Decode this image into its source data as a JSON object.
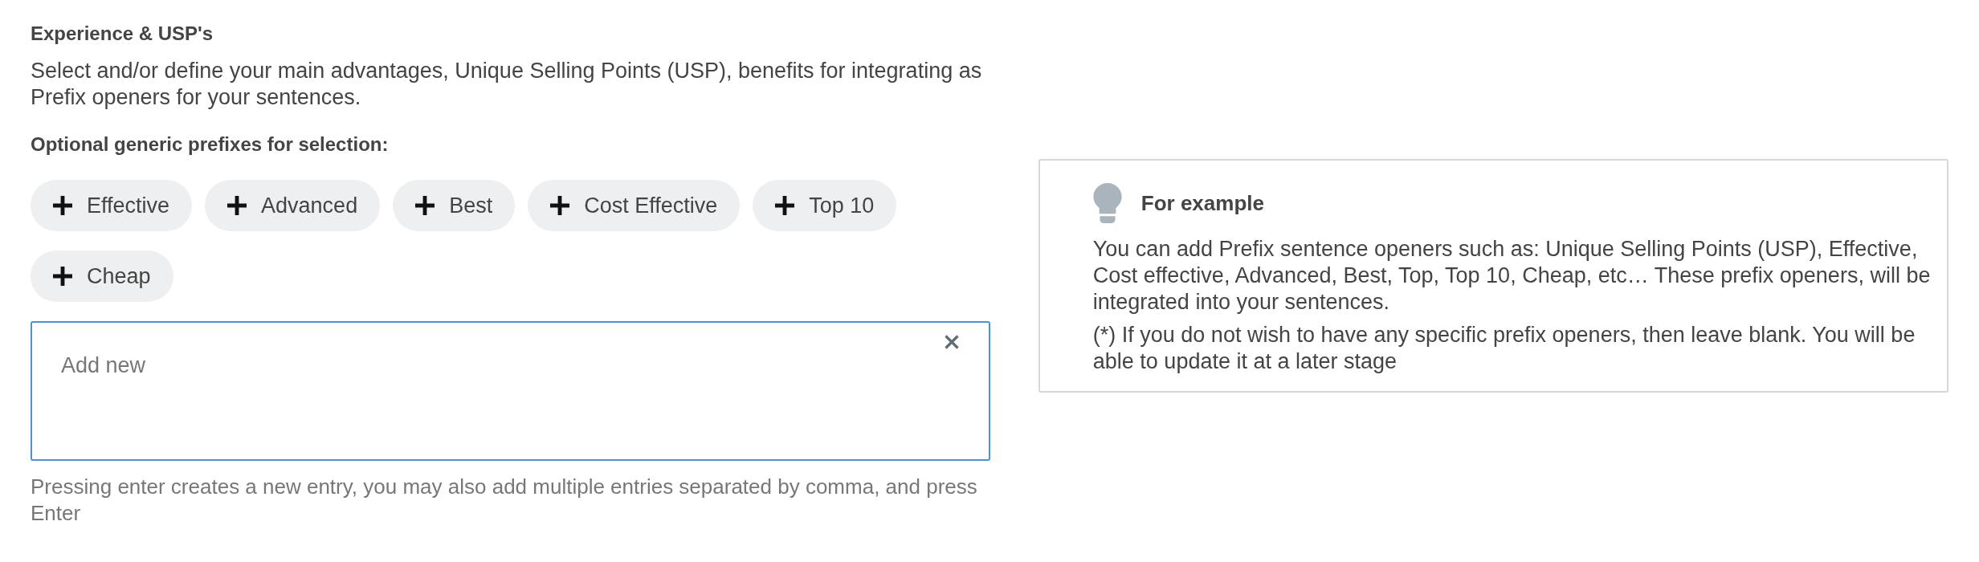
{
  "section": {
    "title": "Experience & USP's",
    "description": "Select and/or define your main advantages, Unique Selling Points (USP), benefits for integrating as Prefix openers for your sentences.",
    "prefixes_label": "Optional generic prefixes for selection:"
  },
  "prefixes": [
    {
      "label": "Effective"
    },
    {
      "label": "Advanced"
    },
    {
      "label": "Best"
    },
    {
      "label": "Cost Effective"
    },
    {
      "label": "Top 10"
    },
    {
      "label": "Cheap"
    }
  ],
  "add_field": {
    "placeholder": "Add new",
    "helper": "Pressing enter creates a new entry, you may also add multiple entries separated by comma, and press Enter"
  },
  "example_card": {
    "title": "For example",
    "paragraphs": [
      "You can add Prefix sentence openers such as: Unique Selling Points (USP), Effective, Cost effective, Advanced, Best, Top, Top 10, Cheap, etc… These prefix openers, will be integrated into your sentences.",
      "(*) If you do not wish to have any specific prefix openers, then leave blank. You will be able to update it at a later stage"
    ]
  }
}
